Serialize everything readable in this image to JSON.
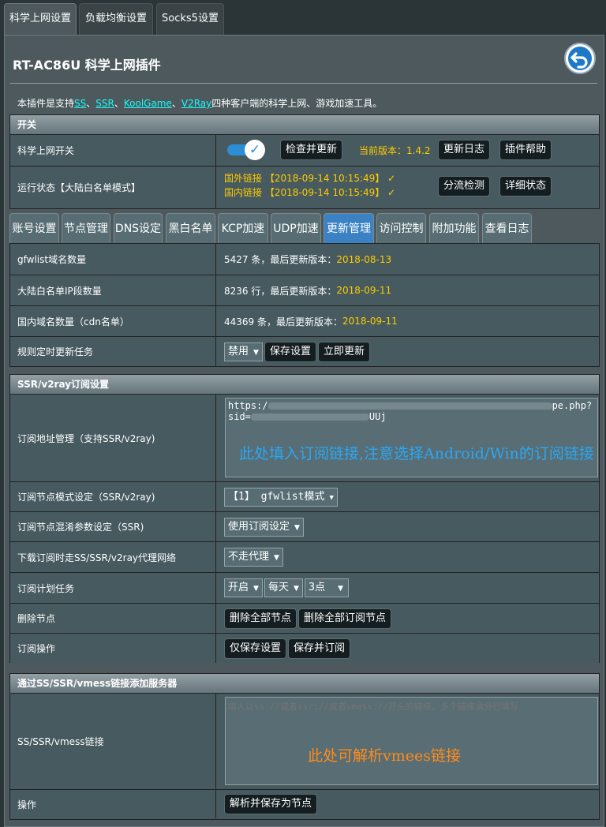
{
  "top_tabs": [
    "科学上网设置",
    "负载均衡设置",
    "Socks5设置"
  ],
  "title": "RT-AC86U 科学上网插件",
  "intro": {
    "prefix": "本插件是支持",
    "links": [
      "SS",
      "SSR",
      "KoolGame",
      "V2Ray"
    ],
    "sep": "、",
    "suffix": "四种客户端的科学上网、游戏加速工具。"
  },
  "switch_section": {
    "header": "开关",
    "switch_label": "科学上网开关",
    "switch_on": true,
    "check_update": "检查并更新",
    "version_label": "当前版本：1.4.2",
    "changelog": "更新日志",
    "plugin_help": "插件帮助",
    "status_label": "运行状态【大陆白名单模式】",
    "status_foreign": "国外链接 【2018-09-14 10:15:49】 ✓",
    "status_domestic": "国内链接 【2018-09-14 10:15:49】 ✓",
    "split_check": "分流检测",
    "detail_status": "详细状态"
  },
  "sub_tabs": [
    "账号设置",
    "节点管理",
    "DNS设定",
    "黑白名单",
    "KCP加速",
    "UDP加速",
    "更新管理",
    "访问控制",
    "附加功能",
    "查看日志"
  ],
  "update_table": {
    "rows": [
      {
        "label": "gfwlist域名数量",
        "count": "5427 条，最后更新版本：",
        "version": "2018-08-13"
      },
      {
        "label": "大陆白名单IP段数量",
        "count": "8236 行，最后更新版本：",
        "version": "2018-09-11"
      },
      {
        "label": "国内域名数量（cdn名单）",
        "count": "44369 条，最后更新版本：",
        "version": "2018-09-11"
      }
    ],
    "cron_label": "规则定时更新任务",
    "cron_select": "禁用",
    "save": "保存设置",
    "update_now": "立即更新"
  },
  "sub_section": {
    "header": "SSR/v2ray订阅设置",
    "url_label": "订阅地址管理（支持SSR/v2ray)",
    "url_line1": "https:/",
    "url_line1_end": "pe.php?",
    "url_line2": "sid=",
    "url_line2_end": "UUj",
    "url_hint": "此处填入订阅链接,注意选择Android/Win的订阅链接",
    "mode_label": "订阅节点模式设定（SSR/v2ray)",
    "mode_select": "【1】 gfwlist模式",
    "obfs_label": "订阅节点混淆参数设定（SSR)",
    "obfs_select": "使用订阅设定",
    "proxy_label": "下载订阅时走SS/SSR/v2ray代理网络",
    "proxy_select": "不走代理",
    "plan_label": "订阅计划任务",
    "plan_selects": [
      "开启",
      "每天",
      "3点"
    ],
    "delete_label": "删除节点",
    "delete_all": "删除全部节点",
    "delete_sub": "删除全部订阅节点",
    "op_label": "订阅操作",
    "save_only": "仅保存设置",
    "save_sub": "保存并订阅"
  },
  "link_section": {
    "header": "通过SS/SSR/vmess链接添加服务器",
    "link_label": "SS/SSR/vmess链接",
    "placeholder": "填入以ss://或者ssr://或者vmess://开头的链接，多个链接请分行填写",
    "hint": "此处可解析vmees链接",
    "op_label": "操作",
    "parse_btn": "解析并保存为节点"
  }
}
